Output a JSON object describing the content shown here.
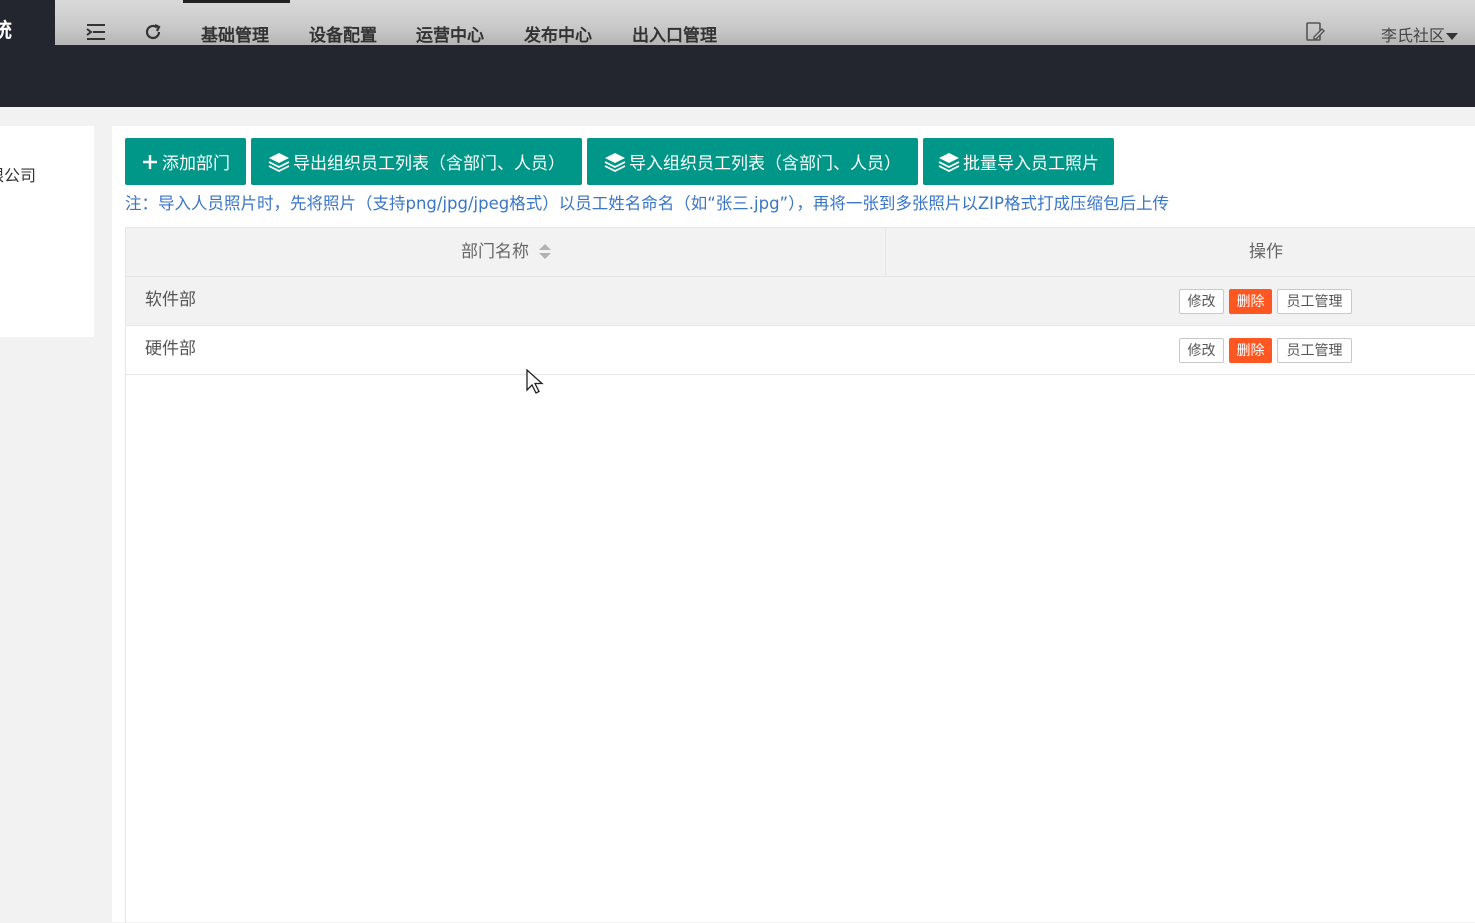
{
  "header": {
    "logo_text": "统",
    "nav": [
      "基础管理",
      "设备配置",
      "运营中心",
      "发布中心",
      "出入口管理"
    ],
    "active_nav": "基础管理",
    "user": "李氏社区"
  },
  "tree": {
    "root_node": "限公司"
  },
  "toolbar": {
    "add_dept": "添加部门",
    "export": "导出组织员工列表（含部门、人员）",
    "import": "导入组织员工列表（含部门、人员）",
    "batch_photos": "批量导入员工照片"
  },
  "note": "注：导入人员照片时，先将照片（支持png/jpg/jpeg格式）以员工姓名命名（如“张三.jpg”），再将一张到多张照片以ZIP格式打成压缩包后上传",
  "table": {
    "headers": {
      "name": "部门名称",
      "actions": "操作"
    },
    "rows": [
      {
        "name": "软件部"
      },
      {
        "name": "硬件部"
      }
    ],
    "row_actions": {
      "edit": "修改",
      "delete": "删除",
      "staff": "员工管理"
    }
  },
  "colors": {
    "primary": "#009688",
    "danger": "#ff5722",
    "note": "#3a76c6",
    "dark": "#23262e"
  }
}
